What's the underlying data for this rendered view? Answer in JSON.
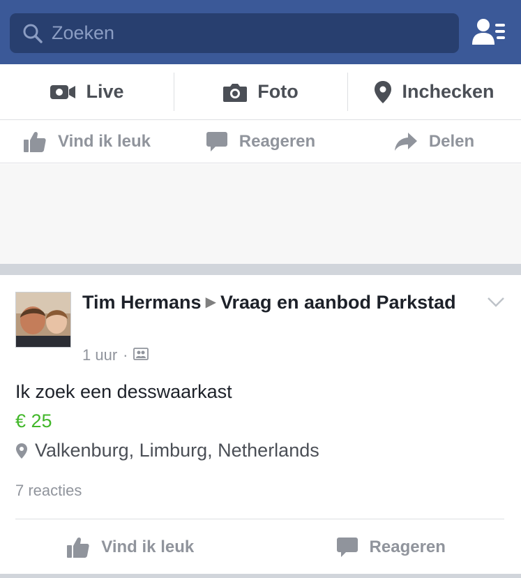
{
  "search": {
    "placeholder": "Zoeken",
    "icon": "search-icon"
  },
  "header": {
    "friends_icon": "friend-requests-icon"
  },
  "composer": {
    "items": [
      {
        "label": "Live",
        "icon": "video-icon"
      },
      {
        "label": "Foto",
        "icon": "camera-icon"
      },
      {
        "label": "Inchecken",
        "icon": "location-pin-icon"
      }
    ]
  },
  "top_actions": {
    "like": "Vind ik leuk",
    "comment": "Reageren",
    "share": "Delen"
  },
  "post": {
    "author": "Tim Hermans",
    "group": "Vraag en aanbod Parkstad",
    "time": "1 uur",
    "title": "Ik zoek een desswaarkast",
    "price": "€ 25",
    "location": "Valkenburg, Limburg, Netherlands",
    "reactions": "7 reacties",
    "like_label": "Vind ik leuk",
    "comment_label": "Reageren"
  },
  "colors": {
    "header_bg": "#3b5998",
    "search_bg": "#283f6f",
    "price": "#42b72a",
    "muted": "#90949c"
  }
}
